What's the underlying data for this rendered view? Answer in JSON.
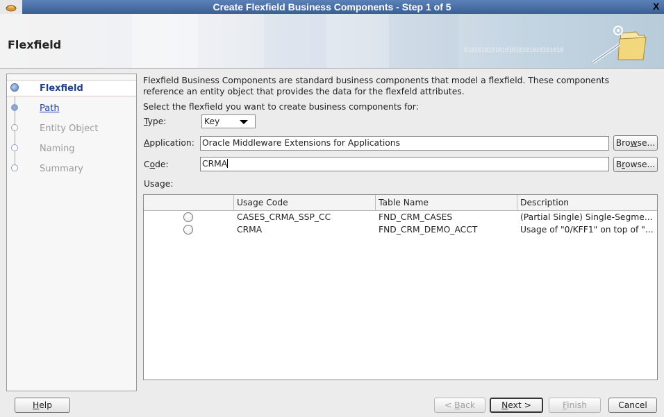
{
  "window": {
    "title": "Create Flexfield Business Components - Step 1 of 5",
    "close_glyph": "X"
  },
  "banner": {
    "heading": "Flexfield",
    "binary_text": "01010101010101010101010101010"
  },
  "steps": [
    {
      "label": "Flexfield",
      "state": "active"
    },
    {
      "label": "Path",
      "state": "link"
    },
    {
      "label": "Entity Object",
      "state": "disabled"
    },
    {
      "label": "Naming",
      "state": "disabled"
    },
    {
      "label": "Summary",
      "state": "disabled"
    }
  ],
  "main": {
    "description_line1": "Flexfield Business Components are standard business components that model a flexfield. These components",
    "description_line2": "reference an entity object that provides the data for the flexfeld attributes.",
    "prompt": "Select the flexfield you want to create business components for:",
    "type_label_mnemonic": "T",
    "type_label_rest": "ype:",
    "type_value": "Key",
    "application_label_mnemonic": "A",
    "application_label_rest": "pplication:",
    "application_value": "Oracle Middleware Extensions for Applications",
    "code_label_pre": "C",
    "code_label_mnemonic": "o",
    "code_label_rest": "de:",
    "code_value": "CRMA",
    "browse1_pre": "Bro",
    "browse1_mnemonic": "w",
    "browse1_rest": "se...",
    "browse2_pre": "B",
    "browse2_mnemonic": "r",
    "browse2_rest": "owse...",
    "usage_label": "Usage:"
  },
  "usage_table": {
    "columns": [
      "",
      "Usage Code",
      "Table Name",
      "Description"
    ],
    "rows": [
      {
        "usage_code": "CASES_CRMA_SSP_CC",
        "table_name": "FND_CRM_CASES",
        "description": "(Partial Single) Single-Segme..."
      },
      {
        "usage_code": "CRMA",
        "table_name": "FND_CRM_DEMO_ACCT",
        "description": "Usage of \"0/KFF1\" on top of \"..."
      }
    ]
  },
  "footer": {
    "help_mnemonic": "H",
    "help_rest": "elp",
    "back_pre": "< ",
    "back_mnemonic": "B",
    "back_rest": "ack",
    "next_mnemonic": "N",
    "next_rest": "ext >",
    "finish_mnemonic": "F",
    "finish_rest": "inish",
    "cancel_label": "Cancel"
  },
  "colors": {
    "titlebar": "#3b5f95",
    "active_step_text": "#1d3f8a",
    "link_text": "#1e3fa0"
  }
}
